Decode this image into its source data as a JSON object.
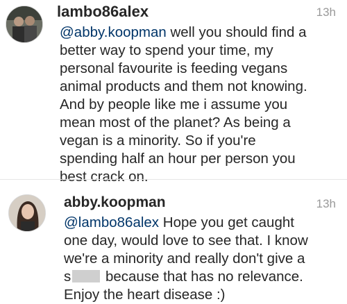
{
  "comments": [
    {
      "username": "lambo86alex",
      "time": "13h",
      "mention": "@abby.koopman",
      "lines": [
        " well you should find a",
        "better way to spend your time, my",
        "personal favourite is feeding vegans",
        "animal products and them not knowing.",
        "And by people like me i assume you",
        "mean most of the planet? As being a",
        "vegan is a minority. So if you're",
        "spending half an hour per person you",
        "best crack on."
      ]
    },
    {
      "username": "abby.koopman",
      "time": "13h",
      "mention": "@lambo86alex",
      "lines": [
        " Hope you get caught",
        "one day, would love to see that. I know",
        "we're a minority and really don't give a",
        "s",
        " because that has no relevance.",
        "Enjoy the heart disease :)"
      ]
    }
  ]
}
